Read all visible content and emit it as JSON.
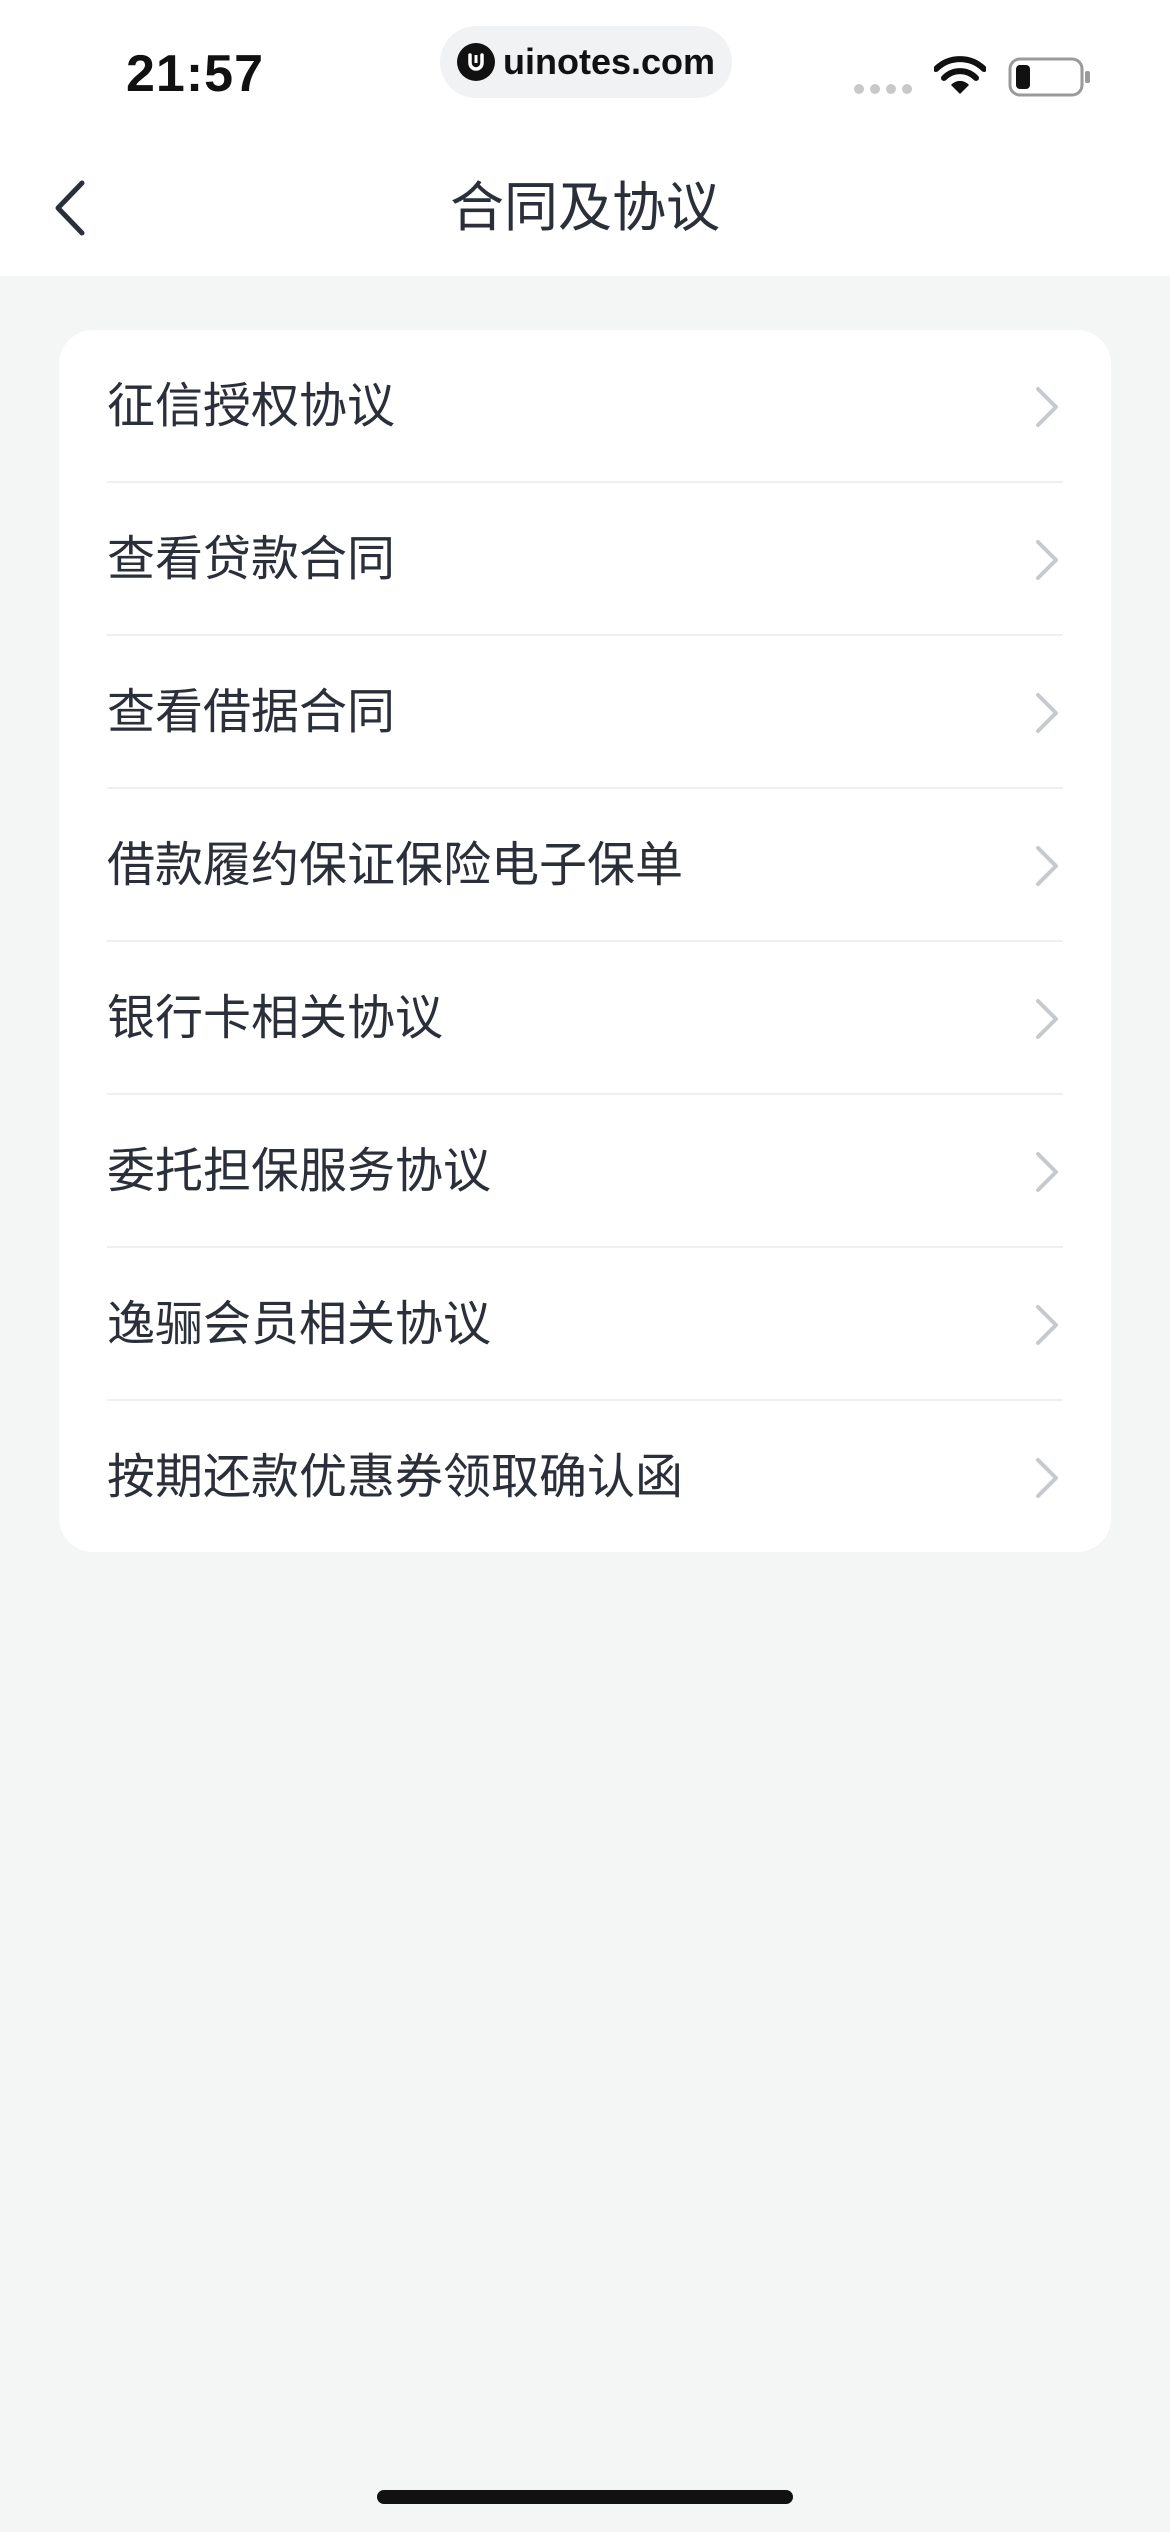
{
  "status_bar": {
    "time": "21:57",
    "url": "uinotes.com",
    "icons": [
      "signal-icon",
      "wifi-icon",
      "battery-icon"
    ]
  },
  "nav": {
    "title": "合同及协议",
    "back_icon": "chevron-left-icon"
  },
  "list": {
    "items": [
      {
        "label": "征信授权协议"
      },
      {
        "label": "查看贷款合同"
      },
      {
        "label": "查看借据合同"
      },
      {
        "label": "借款履约保证保险电子保单"
      },
      {
        "label": "银行卡相关协议"
      },
      {
        "label": "委托担保服务协议"
      },
      {
        "label": "逸骊会员相关协议"
      },
      {
        "label": "按期还款优惠券领取确认函"
      }
    ],
    "item_icon": "chevron-right-icon"
  },
  "colors": {
    "background": "#f4f6f6",
    "card": "#ffffff",
    "text": "#2a2f3a",
    "chevron": "#c6c9ce",
    "divider": "#eeeff1"
  }
}
